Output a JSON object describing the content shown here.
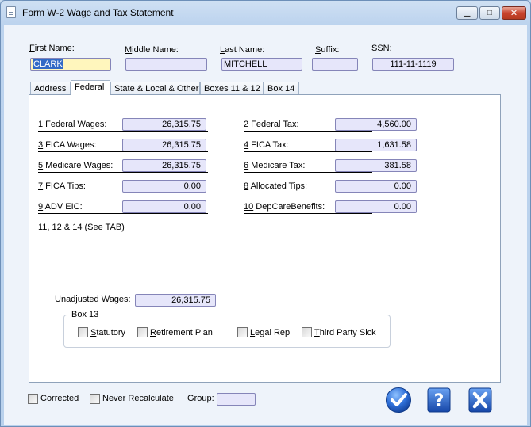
{
  "window": {
    "title": "Form W-2 Wage and Tax Statement",
    "minimize_glyph": "▁",
    "maximize_glyph": "□",
    "close_glyph": "✕"
  },
  "header": {
    "first_name_label": "First Name:",
    "first_name_value": "CLARK",
    "middle_name_label": "Middle Name:",
    "middle_name_value": "",
    "last_name_label": "Last Name:",
    "last_name_value": "MITCHELL",
    "suffix_label": "Suffix:",
    "suffix_value": "",
    "ssn_label": "SSN:",
    "ssn_value": "111-11-1119"
  },
  "tabs": [
    "Address",
    "Federal",
    "State & Local & Other",
    "Boxes 11 & 12",
    "Box 14"
  ],
  "active_tab": "Federal",
  "federal": {
    "rows": [
      {
        "left_num": "1",
        "left_label": " Federal Wages:",
        "left_value": "26,315.75",
        "right_num": "2",
        "right_label": " Federal Tax:",
        "right_value": "4,560.00"
      },
      {
        "left_num": "3",
        "left_label": " FICA Wages:",
        "left_value": "26,315.75",
        "right_num": "4",
        "right_label": " FICA Tax:",
        "right_value": "1,631.58"
      },
      {
        "left_num": "5",
        "left_label": " Medicare Wages:",
        "left_value": "26,315.75",
        "right_num": "6",
        "right_label": " Medicare Tax:",
        "right_value": "381.58"
      },
      {
        "left_num": "7",
        "left_label": " FICA Tips:",
        "left_value": "0.00",
        "right_num": "8",
        "right_label": " Allocated Tips:",
        "right_value": "0.00"
      },
      {
        "left_num": "9",
        "left_label": " ADV EIC:",
        "left_value": "0.00",
        "right_num": "10",
        "right_label": " DepCareBenefits:",
        "right_value": "0.00"
      }
    ],
    "see_tab_note": "11, 12 & 14 (See TAB)",
    "box13_title": "Box 13",
    "box13_items": [
      {
        "label": "Statutory",
        "checked": false
      },
      {
        "label": "Retirement Plan",
        "checked": false
      },
      {
        "label": "Legal Rep",
        "checked": false
      },
      {
        "label": "Third Party Sick",
        "checked": false
      }
    ],
    "unadjusted_label": "Unadjusted Wages:",
    "unadjusted_value": "26,315.75"
  },
  "footer": {
    "corrected_label": "Corrected",
    "corrected_checked": false,
    "never_recalc_label": "Never Recalculate",
    "never_recalc_checked": false,
    "group_label": "Group:",
    "group_value": "",
    "ok_icon": "checkmark-icon",
    "help_icon": "help-icon",
    "cancel_icon": "cancel-x-icon"
  },
  "colors": {
    "field_bg": "#e6e6fa",
    "field_border": "#8585b8",
    "accent_blue": "#2e6fd8",
    "selection": "#3169c6"
  }
}
